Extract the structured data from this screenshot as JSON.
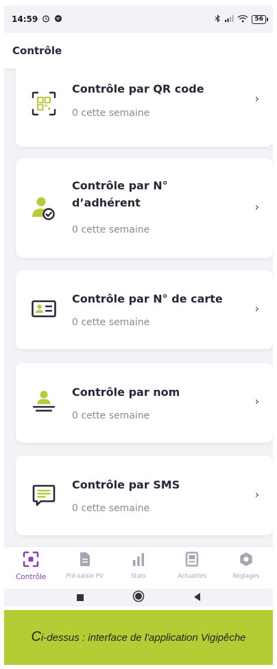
{
  "status_bar": {
    "time": "14:59",
    "battery": "56"
  },
  "app_bar": {
    "title": "Contrôle"
  },
  "cards": [
    {
      "title": "Contrôle par QR code",
      "subtitle": "0 cette semaine",
      "icon": "qr-code-icon"
    },
    {
      "title": "Contrôle par N° d’adhérent",
      "subtitle": "0 cette semaine",
      "icon": "member-check-icon"
    },
    {
      "title": "Contrôle par N° de carte",
      "subtitle": "0 cette semaine",
      "icon": "id-card-icon"
    },
    {
      "title": "Contrôle par nom",
      "subtitle": "0 cette semaine",
      "icon": "person-name-icon"
    },
    {
      "title": "Contrôle par SMS",
      "subtitle": "0 cette semaine",
      "icon": "sms-icon"
    }
  ],
  "chevron": "›",
  "bottom_nav": [
    {
      "label": "Contrôle",
      "icon": "scan-icon",
      "active": true
    },
    {
      "label": "Pré-saisie PV",
      "icon": "document-icon",
      "active": false
    },
    {
      "label": "Stats",
      "icon": "bar-chart-icon",
      "active": false
    },
    {
      "label": "Actualités",
      "icon": "news-icon",
      "active": false
    },
    {
      "label": "Réglages",
      "icon": "settings-icon",
      "active": false
    }
  ],
  "caption": {
    "first_letter": "C",
    "rest": "i-dessus : interface de l'application Vigipêche"
  },
  "colors": {
    "accent": "#8b3fb3",
    "icon_green": "#b9c93a",
    "icon_dark": "#2a2438",
    "caption_bg": "#b5cd35"
  }
}
